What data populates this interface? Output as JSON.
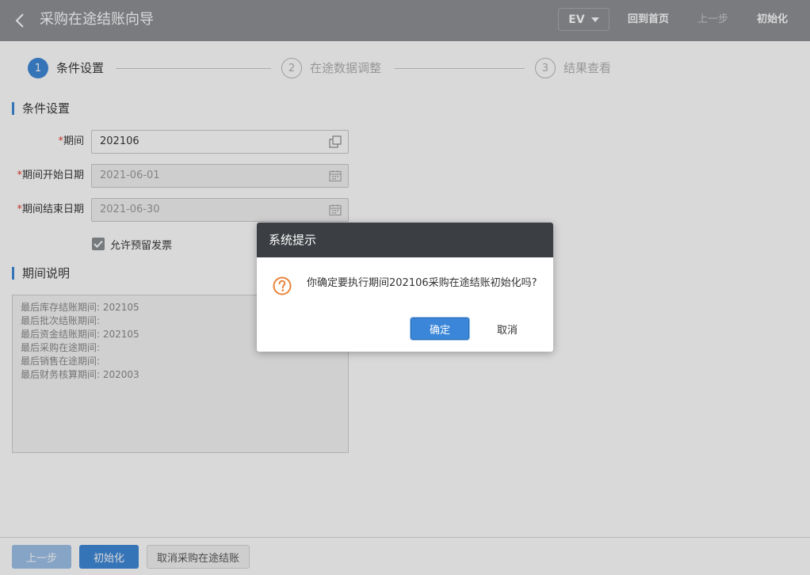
{
  "header": {
    "title": "采购在途结账向导",
    "org_selector": "EV",
    "home_label": "回到首页",
    "prev_label": "上一步",
    "init_label": "初始化",
    "icons": {
      "back": "chevron-left-icon",
      "dropdown": "caret-down-icon"
    }
  },
  "steps": [
    {
      "num": "1",
      "label": "条件设置",
      "active": true
    },
    {
      "num": "2",
      "label": "在途数据调整",
      "active": false
    },
    {
      "num": "3",
      "label": "结果查看",
      "active": false
    }
  ],
  "conditions": {
    "section_title": "条件设置",
    "required_mark": "*",
    "period_label": "期间",
    "period_value": "202106",
    "start_label": "期间开始日期",
    "start_value": "2021-06-01",
    "end_label": "期间结束日期",
    "end_value": "2021-06-30",
    "checkbox_label": "允许预留发票",
    "checkbox_checked": true
  },
  "description": {
    "section_title": "期间说明",
    "lines": [
      "最后库存结账期间: 202105",
      "最后批次结账期间:",
      "最后资金结账期间: 202105",
      "最后采购在途期间:",
      "最后销售在途期间:",
      "最后财务核算期间: 202003"
    ]
  },
  "footer": {
    "prev_label": "上一步",
    "init_label": "初始化",
    "cancel_label": "取消采购在途结账"
  },
  "dialog": {
    "title": "系统提示",
    "message": "你确定要执行期间202106采购在途结账初始化吗?",
    "ok_label": "确定",
    "cancel_label": "取消",
    "icon": "question-circle-icon"
  },
  "colors": {
    "header_bg": "#8c8f93",
    "accent": "#3b86d8",
    "dialog_header": "#3b3e42",
    "question_icon": "#e8833a",
    "required": "#e33b2e"
  }
}
